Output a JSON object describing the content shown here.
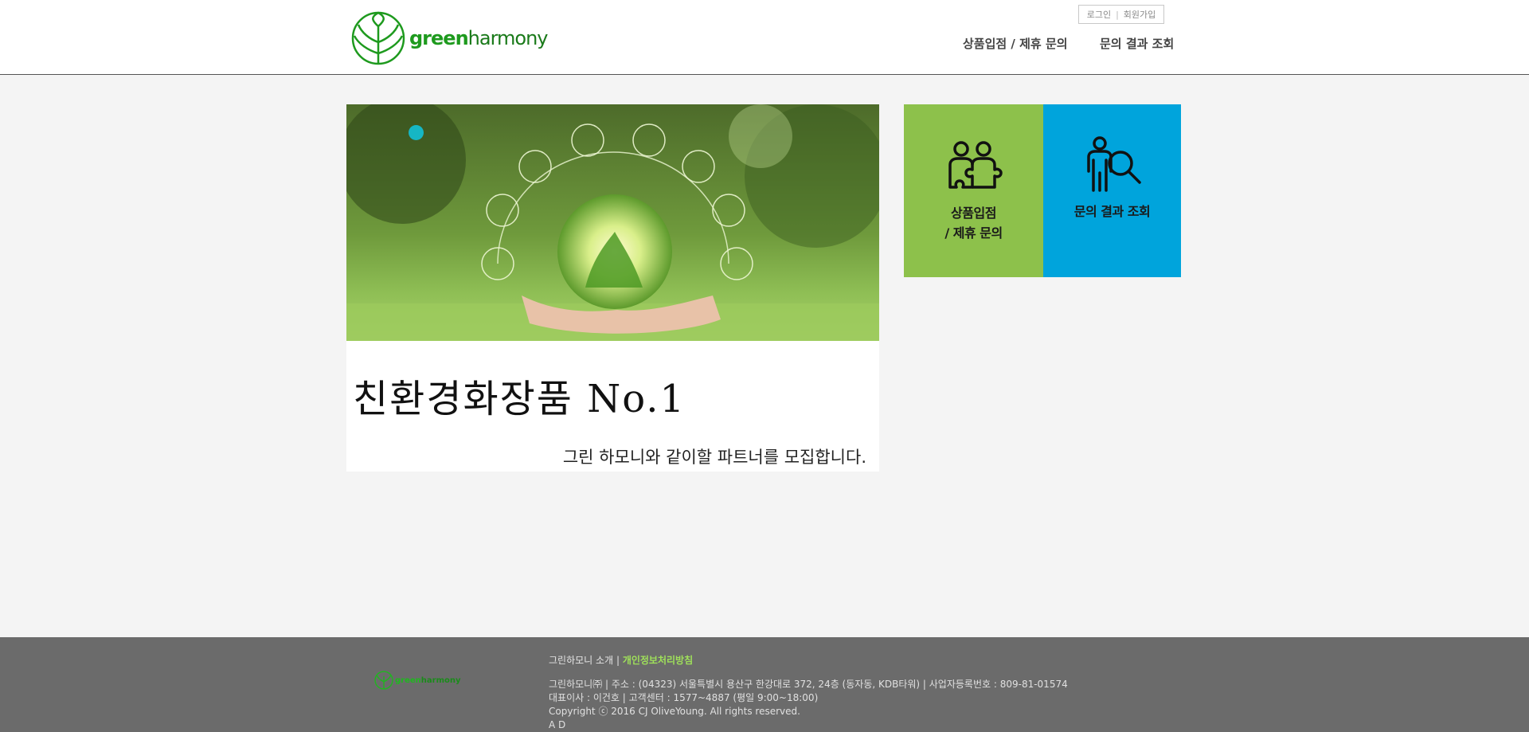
{
  "header": {
    "logo_text_green": "green",
    "logo_text_harmony": "harmony",
    "top_links": {
      "login": "로그인",
      "separator": "|",
      "signup": "회원가입"
    },
    "nav": [
      {
        "label": "상품입점 / 제휴 문의"
      },
      {
        "label": "문의 결과 조회"
      }
    ]
  },
  "banner": {
    "headline": "친환경화장품  No.1",
    "subline": "그린 하모니와 같이할 파트너를 모집합니다."
  },
  "tiles": [
    {
      "line1": "상품입점",
      "line2": "/ 제휴 문의",
      "icon": "puzzle-people-icon",
      "color": "#8dc14b"
    },
    {
      "line1": "문의 결과 조회",
      "icon": "person-search-icon",
      "color": "#00a4dc"
    }
  ],
  "footer": {
    "logo_text_green": "green",
    "logo_text_harmony": "harmony",
    "about": "그린하모니 소개",
    "separator": "|",
    "privacy": "개인정보처리방침",
    "info_line1": "그린하모니㈜ | 주소 : (04323) 서울특별시 용산구 한강대로 372, 24층 (동자동, KDB타워) | 사업자등록번호 : 809-81-01574",
    "info_line2": "대표이사 : 이건호 | 고객센터 : 1577~4887 (평일 9:00~18:00)",
    "info_line3": "Copyright ⓒ 2016 CJ OliveYoung. All rights reserved.",
    "info_line4": "A D"
  },
  "colors": {
    "brand_green": "#1e9a1e",
    "tile_green": "#8dc14b",
    "tile_blue": "#00a4dc",
    "footer_bg": "#6b6b6b",
    "slider_dot": "#16b6c4"
  }
}
